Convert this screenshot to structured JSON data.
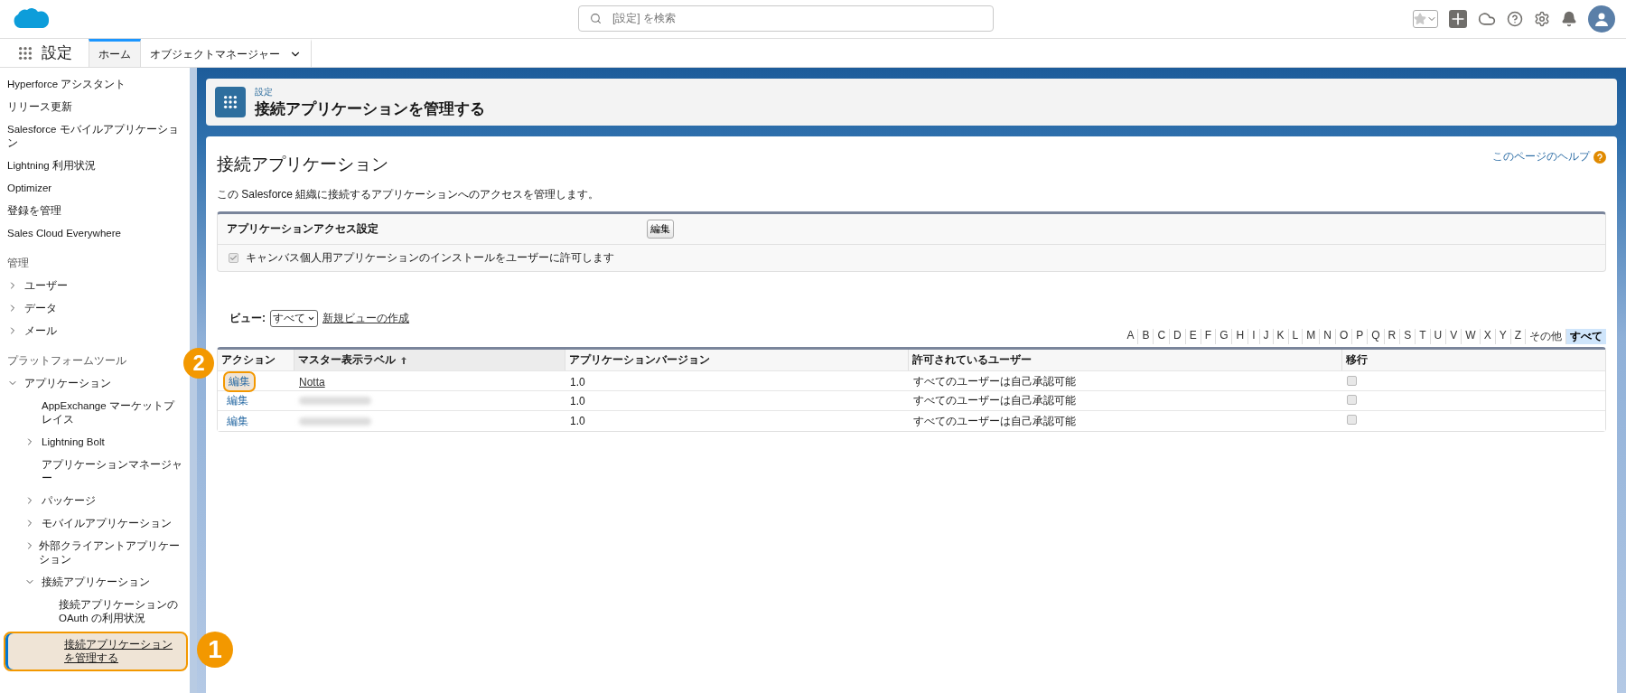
{
  "top_bar": {
    "search": {
      "placeholder": "[設定] を検索"
    }
  },
  "nav": {
    "app_name": "設定",
    "tabs": [
      {
        "label": "ホーム",
        "selected": true,
        "has_menu": false
      },
      {
        "label": "オブジェクトマネージャー",
        "selected": false,
        "has_menu": true
      }
    ]
  },
  "sidebar": {
    "items": [
      {
        "kind": "link",
        "label": "Hyperforce アシスタント",
        "selected": false
      },
      {
        "kind": "link",
        "label": "リリース更新",
        "selected": false
      },
      {
        "kind": "link",
        "label": "Salesforce モバイルアプリケーション",
        "selected": false
      },
      {
        "kind": "link",
        "label": "Lightning 利用状況",
        "selected": false
      },
      {
        "kind": "link",
        "label": "Optimizer",
        "selected": false
      },
      {
        "kind": "link",
        "label": "登録を管理",
        "selected": false
      },
      {
        "kind": "link",
        "label": "Sales Cloud Everywhere",
        "selected": false
      },
      {
        "kind": "heading",
        "label": "管理"
      },
      {
        "kind": "group",
        "label": "ユーザー",
        "expanded": false
      },
      {
        "kind": "group",
        "label": "データ",
        "expanded": false
      },
      {
        "kind": "group",
        "label": "メール",
        "expanded": false
      },
      {
        "kind": "heading",
        "label": "プラットフォームツール"
      },
      {
        "kind": "group",
        "label": "アプリケーション",
        "expanded": true,
        "children": [
          {
            "kind": "link",
            "label": "AppExchange マーケットプレイス",
            "selected": false
          },
          {
            "kind": "group",
            "label": "Lightning Bolt",
            "expanded": false
          },
          {
            "kind": "link",
            "label": "アプリケーションマネージャー",
            "selected": false
          },
          {
            "kind": "group",
            "label": "パッケージ",
            "expanded": false
          },
          {
            "kind": "group",
            "label": "モバイルアプリケーション",
            "expanded": false
          },
          {
            "kind": "group",
            "label": "外部クライアントアプリケーション",
            "expanded": false
          },
          {
            "kind": "group",
            "label": "接続アプリケーション",
            "expanded": true,
            "children": [
              {
                "kind": "link",
                "label": "接続アプリケーションの OAuth の利用状況",
                "selected": false
              },
              {
                "kind": "link",
                "label": "接続アプリケーションを管理する",
                "selected": true,
                "highlighted": true,
                "callout": "1"
              }
            ]
          }
        ]
      }
    ]
  },
  "page_header": {
    "breadcrumb": "設定",
    "title": "接続アプリケーションを管理する"
  },
  "main": {
    "title": "接続アプリケーション",
    "help_link": "このページのヘルプ",
    "description": "この Salesforce 組織に接続するアプリケーションへのアクセスを管理します。",
    "access_panel": {
      "title": "アプリケーションアクセス設定",
      "edit_button": "編集",
      "option": {
        "label": "キャンバス個人用アプリケーションのインストールをユーザーに許可します",
        "checked": true,
        "disabled": true
      }
    },
    "view": {
      "label": "ビュー:",
      "value": "すべて",
      "new_view_link": "新規ビューの作成"
    },
    "letters": [
      {
        "label": "A",
        "selected": false
      },
      {
        "label": "B",
        "selected": false
      },
      {
        "label": "C",
        "selected": false
      },
      {
        "label": "D",
        "selected": false
      },
      {
        "label": "E",
        "selected": false
      },
      {
        "label": "F",
        "selected": false
      },
      {
        "label": "G",
        "selected": false
      },
      {
        "label": "H",
        "selected": false
      },
      {
        "label": "I",
        "selected": false
      },
      {
        "label": "J",
        "selected": false
      },
      {
        "label": "K",
        "selected": false
      },
      {
        "label": "L",
        "selected": false
      },
      {
        "label": "M",
        "selected": false
      },
      {
        "label": "N",
        "selected": false
      },
      {
        "label": "O",
        "selected": false
      },
      {
        "label": "P",
        "selected": false
      },
      {
        "label": "Q",
        "selected": false
      },
      {
        "label": "R",
        "selected": false
      },
      {
        "label": "S",
        "selected": false
      },
      {
        "label": "T",
        "selected": false
      },
      {
        "label": "U",
        "selected": false
      },
      {
        "label": "V",
        "selected": false
      },
      {
        "label": "W",
        "selected": false
      },
      {
        "label": "X",
        "selected": false
      },
      {
        "label": "Y",
        "selected": false
      },
      {
        "label": "Z",
        "selected": false
      },
      {
        "label": "その他",
        "selected": false
      },
      {
        "label": "すべて",
        "selected": true
      }
    ],
    "table": {
      "columns": [
        {
          "label": "アクション",
          "sorted": false
        },
        {
          "label": "マスター表示ラベル",
          "sorted": true
        },
        {
          "label": "アプリケーションバージョン",
          "sorted": false
        },
        {
          "label": "許可されているユーザー",
          "sorted": false
        },
        {
          "label": "移行",
          "sorted": false
        }
      ],
      "rows": [
        {
          "action": "編集",
          "highlighted": true,
          "callout": "2",
          "label": "Notta",
          "redacted": false,
          "version": "1.0",
          "users": "すべてのユーザーは自己承認可能",
          "migrated": false
        },
        {
          "action": "編集",
          "highlighted": false,
          "redacted": true,
          "version": "1.0",
          "users": "すべてのユーザーは自己承認可能",
          "migrated": false
        },
        {
          "action": "編集",
          "highlighted": false,
          "redacted": true,
          "version": "1.0",
          "users": "すべてのユーザーは自己承認可能",
          "migrated": false
        }
      ]
    }
  }
}
